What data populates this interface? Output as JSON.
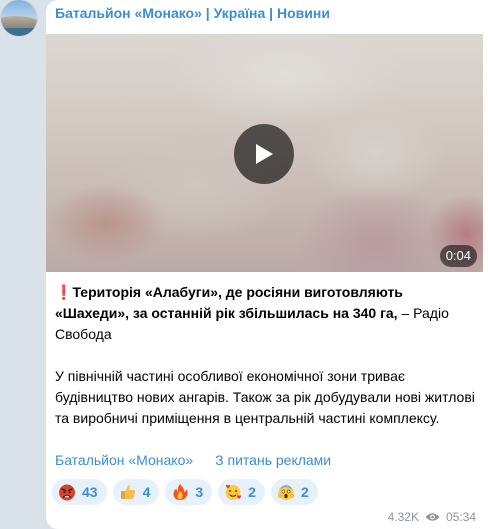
{
  "channel": {
    "name": "Батальйон «Монако» | Україна | Новини",
    "avatar_icon": "channel-avatar"
  },
  "video": {
    "duration": "0:04",
    "play_icon": "play-icon"
  },
  "post": {
    "exclaim": "❗️",
    "headline_bold": "Територія «Алабуги», де росіяни виготовляють «Шахеди», за останній рік збільшилась на 340 га,",
    "headline_source": " – Радіо Свобода",
    "body": "У північній частині особливої економічної зони триває будівництво нових ангарів. Також за рік добудували нові житлові та виробничі приміщення в центральній частині комплексу."
  },
  "links": {
    "channel": "Батальйон «Монако»",
    "ads": "З питань реклами"
  },
  "reactions": [
    {
      "icon": "angry-face-icon",
      "count": "43"
    },
    {
      "icon": "thumbs-up-icon",
      "count": "4"
    },
    {
      "icon": "fire-icon",
      "count": "3"
    },
    {
      "icon": "smiling-hearts-face-icon",
      "count": "2"
    },
    {
      "icon": "screaming-face-icon",
      "count": "2"
    }
  ],
  "meta": {
    "views": "4.32K",
    "time": "05:34",
    "views_icon": "eye-icon"
  },
  "colors": {
    "link": "#3a8ed2",
    "reaction_bg": "#e6f1fb",
    "meta": "#8a97a3",
    "background": "#d9e2e8"
  }
}
